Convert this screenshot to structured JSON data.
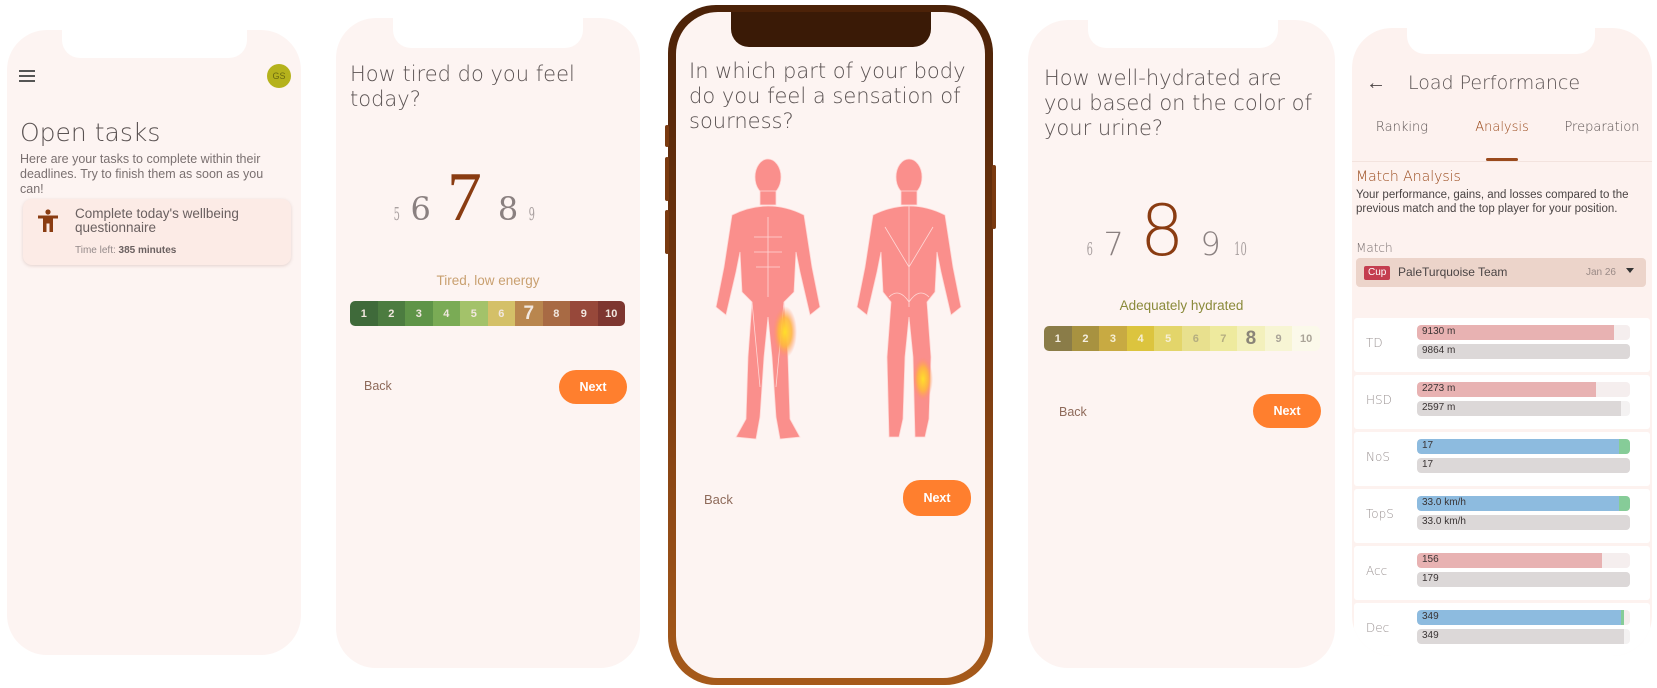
{
  "tasks_screen": {
    "avatar_initials": "GS",
    "title": "Open tasks",
    "subtitle": "Here are your tasks to complete within their deadlines. Try to finish them as soon as you can!",
    "tasks": [
      {
        "icon": "accessibility-person-icon",
        "title": "Complete today's wellbeing questionnaire",
        "time_left_label": "Time left:",
        "time_left_value": "385 minutes"
      }
    ]
  },
  "tiredness_screen": {
    "question": "How tired do you feel today?",
    "picker": {
      "far_left": "5",
      "left": "6",
      "selected": "7",
      "right": "8",
      "far_right": "9"
    },
    "selected_value": 7,
    "scale_label": "Tired, low energy",
    "scale_color": "#c9a070",
    "scale": [
      {
        "value": "1",
        "color": "#3f6a3a"
      },
      {
        "value": "2",
        "color": "#4c7c40"
      },
      {
        "value": "3",
        "color": "#5f9448"
      },
      {
        "value": "4",
        "color": "#7aab55"
      },
      {
        "value": "5",
        "color": "#a3c26a"
      },
      {
        "value": "6",
        "color": "#d4c068"
      },
      {
        "value": "7",
        "color": "#b9864e"
      },
      {
        "value": "8",
        "color": "#a86a44"
      },
      {
        "value": "9",
        "color": "#97483a"
      },
      {
        "value": "10",
        "color": "#7e3630"
      }
    ],
    "back_label": "Back",
    "next_label": "Next"
  },
  "soreness_screen": {
    "question": "In which part of your body do you feel a sensation of sourness?",
    "figures": [
      "front-body",
      "back-body"
    ],
    "highlighted_areas": [
      "left quadriceps (front)",
      "right calf (back)"
    ],
    "back_label": "Back",
    "next_label": "Next"
  },
  "hydration_screen": {
    "question": "How well-hydrated are you based on the color of your urine?",
    "picker": {
      "far_left": "6",
      "left": "7",
      "selected": "8",
      "right": "9",
      "far_right": "10"
    },
    "selected_value": 8,
    "scale_label": "Adequately hydrated",
    "scale_color": "#8a8a3a",
    "scale": [
      {
        "value": "1",
        "color": "#8a7c48",
        "text": "#f4eee0"
      },
      {
        "value": "2",
        "color": "#a89240",
        "text": "#f4eee0"
      },
      {
        "value": "3",
        "color": "#c8aa42",
        "text": "#f6efd5"
      },
      {
        "value": "4",
        "color": "#dcc43e",
        "text": "#f6efd5"
      },
      {
        "value": "5",
        "color": "#e3d56a",
        "text": "#f6efd5"
      },
      {
        "value": "6",
        "color": "#e8e08e",
        "text": "#b4ad80"
      },
      {
        "value": "7",
        "color": "#eeea9e",
        "text": "#b4ad80"
      },
      {
        "value": "8",
        "color": "#f3f0bc",
        "text": "#8a8478"
      },
      {
        "value": "9",
        "color": "#f7f5d4",
        "text": "#aaa498"
      },
      {
        "value": "10",
        "color": "#fbf9ea",
        "text": "#aaa498"
      }
    ],
    "back_label": "Back",
    "next_label": "Next"
  },
  "performance_screen": {
    "title": "Load Performance",
    "tabs": [
      {
        "label": "Ranking",
        "active": false
      },
      {
        "label": "Analysis",
        "active": true
      },
      {
        "label": "Preparation",
        "active": false
      }
    ],
    "section_title": "Match Analysis",
    "section_subtitle": "Your performance, gains, and losses compared to the previous match and the top player for your position.",
    "match_label": "Match",
    "match": {
      "badge": "Cup",
      "team": "PaleTurquoise Team",
      "date": "Jan 26"
    },
    "metrics": [
      {
        "name": "TD",
        "current": "9130 m",
        "reference": "9864 m",
        "current_ratio": 0.925,
        "reference_ratio": 1.0,
        "trend": "loss",
        "current_value": 9130,
        "reference_value": 9864
      },
      {
        "name": "HSD",
        "current": "2273 m",
        "reference": "2597 m",
        "current_ratio": 0.84,
        "reference_ratio": 0.96,
        "trend": "loss",
        "current_value": 2273,
        "reference_value": 2597
      },
      {
        "name": "NoS",
        "current": "17",
        "reference": "17",
        "current_ratio": 0.95,
        "reference_ratio": 1.0,
        "trend": "gain",
        "current_value": 17,
        "reference_value": 17
      },
      {
        "name": "TopS",
        "current": "33.0 km/h",
        "reference": "33.0 km/h",
        "current_ratio": 0.95,
        "reference_ratio": 1.0,
        "trend": "gain",
        "current_value": 33.0,
        "reference_value": 33.0
      },
      {
        "name": "Acc",
        "current": "156",
        "reference": "179",
        "current_ratio": 0.87,
        "reference_ratio": 1.0,
        "trend": "loss",
        "current_value": 156,
        "reference_value": 179
      },
      {
        "name": "Dec",
        "current": "349",
        "reference": "349",
        "current_ratio": 0.96,
        "reference_ratio": 0.97,
        "trend": "gain",
        "current_value": 349,
        "reference_value": 349
      }
    ],
    "colors": {
      "loss": "#e8b2b2",
      "gain_base": "#8dbbdf",
      "gain_delta": "#86cc98",
      "reference": "#dcd8d8",
      "accent": "#9a4a1c"
    }
  }
}
